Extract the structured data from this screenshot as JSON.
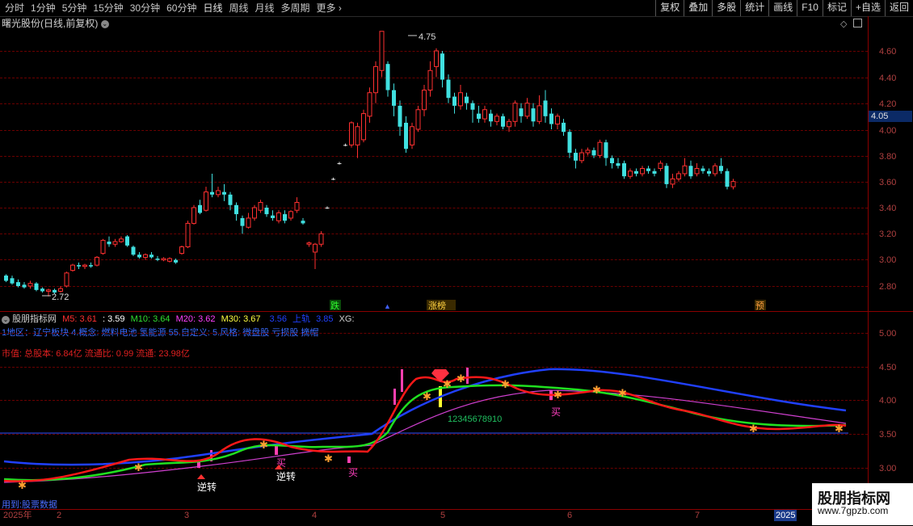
{
  "toolbar": {
    "periods": [
      "分时",
      "1分钟",
      "5分钟",
      "15分钟",
      "30分钟",
      "60分钟",
      "日线",
      "周线",
      "月线",
      "多周期",
      "更多 ›"
    ],
    "active_period": "日线",
    "buttons": [
      "复权",
      "叠加",
      "多股",
      "统计",
      "画线",
      "F10",
      "标记",
      "+自选",
      "返回"
    ]
  },
  "stock": {
    "title": "曙光股份(日线,前复权)",
    "last_price": "4.05"
  },
  "price_axis": [
    "4.60",
    "4.40",
    "4.20",
    "4.00",
    "3.80",
    "3.60",
    "3.40",
    "3.20",
    "3.00",
    "2.80"
  ],
  "annotations": {
    "high": "4.75",
    "low": "2.72"
  },
  "signals": {
    "die": "跌",
    "up_arrow": "▲",
    "zhangting": "涨榜",
    "yu": "预"
  },
  "indicator": {
    "name": "股朋指标网",
    "ma5": "M5: 3.61",
    "ma_extra": ": 3.59",
    "ma10": "M10: 3.64",
    "ma20": "M20: 3.62",
    "ma30": "M30: 3.67",
    "rail_a": "3.56",
    "rail_label": "上轨",
    "rail_b": "3.85",
    "xg": "XG:",
    "line2": "1地区：辽宁板块  4.概念: 燃料电池 氢能源  55.自定义:  5.风格: 微盘股 亏损股 摘帽",
    "line3": "市值: 总股本: 6.84亿 流通比: 0.99 流通: 23.98亿",
    "axis": [
      "5.00",
      "4.50",
      "4.00",
      "3.50",
      "3.00"
    ],
    "labels": {
      "buy": "买",
      "reverse": "逆转",
      "seq": "12345678910"
    }
  },
  "dates": [
    "2025年",
    "2",
    "3",
    "4",
    "5",
    "6",
    "7",
    "2025"
  ],
  "footer_hint": "用到:股票数据",
  "watermark": {
    "line1": "股朋指标网",
    "line2": "www.7gpzb.com"
  },
  "colors": {
    "up": "#ff3030",
    "down": "#40e0e0",
    "ma5": "#ff2020",
    "ma10": "#20e020",
    "ma20": "#ff40ff",
    "ma30": "#ffff40",
    "rail": "#2040ff"
  }
}
